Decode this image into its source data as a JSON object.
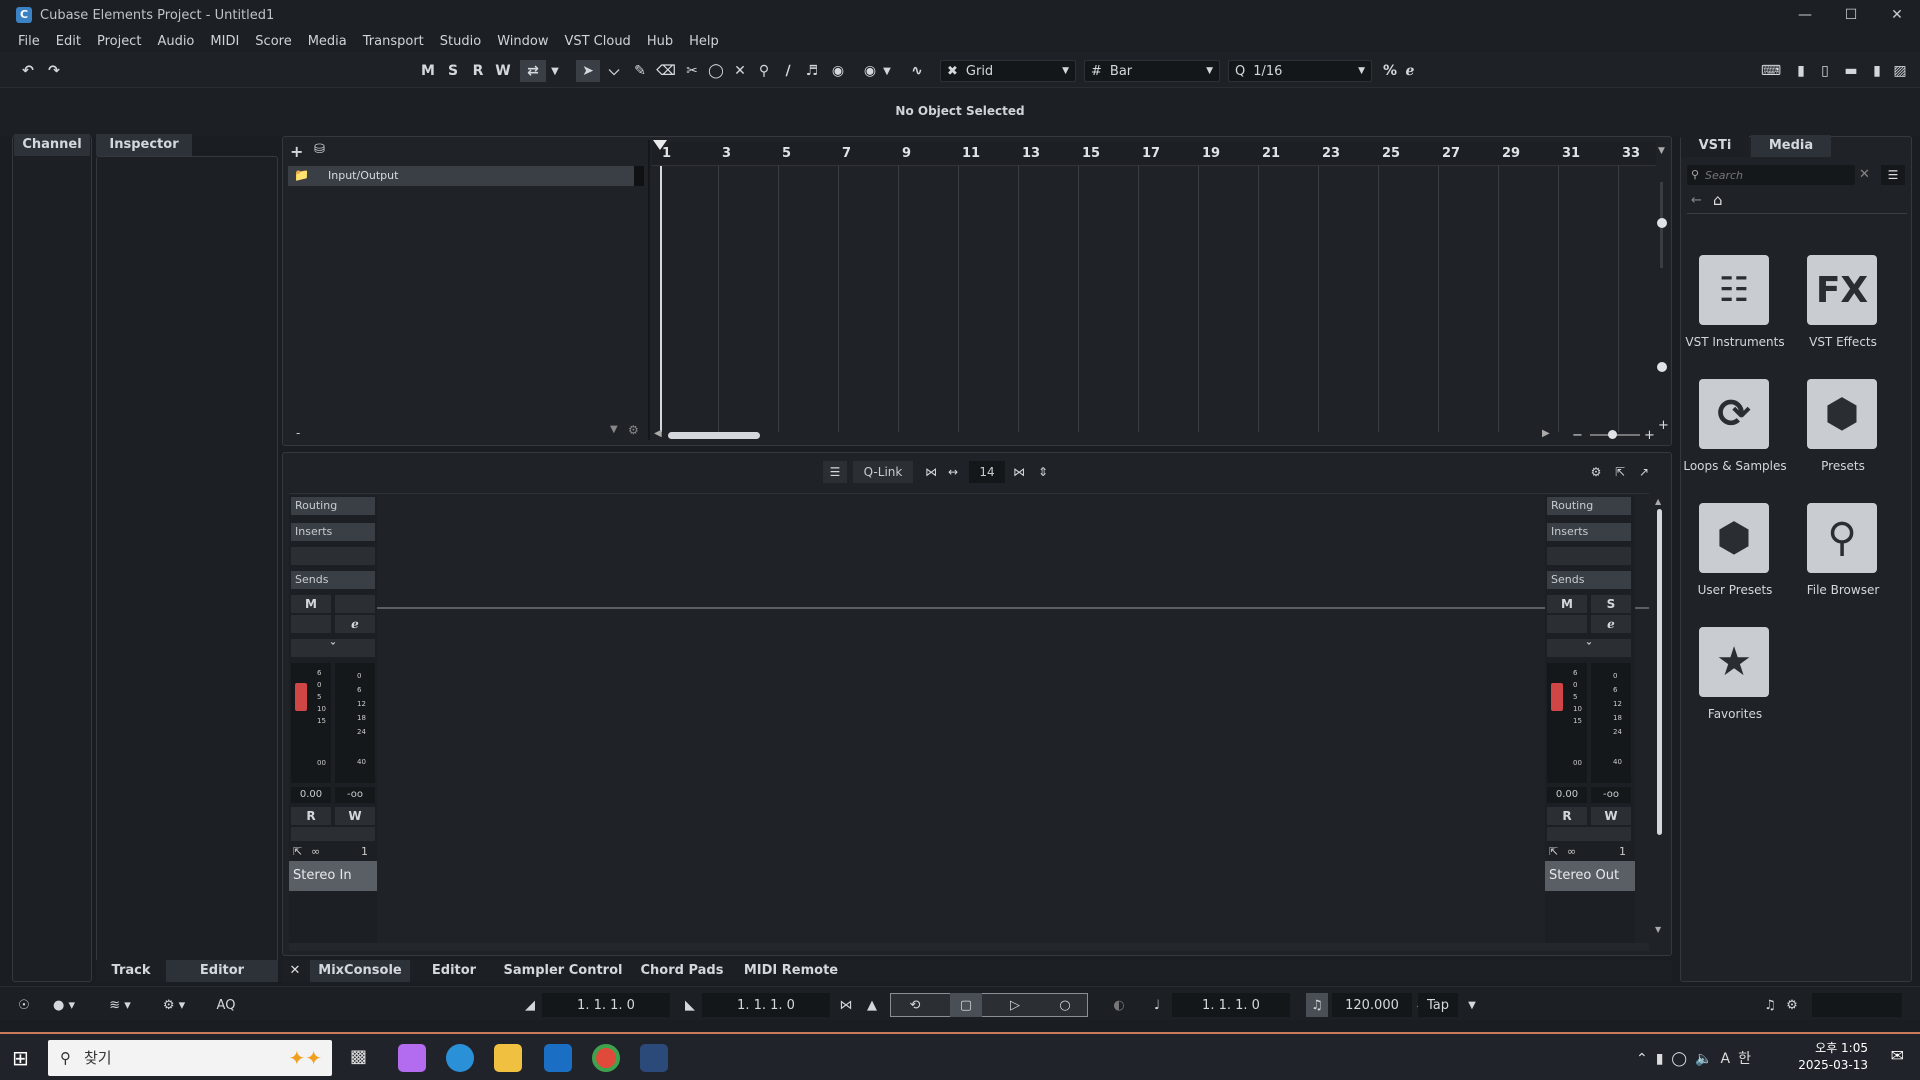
{
  "window": {
    "title": "Cubase Elements Project - Untitled1"
  },
  "menu": [
    "File",
    "Edit",
    "Project",
    "Audio",
    "MIDI",
    "Score",
    "Media",
    "Transport",
    "Studio",
    "Window",
    "VST Cloud",
    "Hub",
    "Help"
  ],
  "toolbar": {
    "m": "M",
    "s": "S",
    "r": "R",
    "w": "W",
    "snap_type": "Grid",
    "grid_type": "Bar",
    "quantize": "1/16"
  },
  "info_line": "No Object Selected",
  "left_tabs": {
    "channel": "Channel",
    "inspector": "Inspector",
    "track": "Track",
    "editor": "Editor"
  },
  "track_list": {
    "folder_name": "Input/Output",
    "footer": "-"
  },
  "ruler": [
    "1",
    "3",
    "5",
    "7",
    "9",
    "11",
    "13",
    "15",
    "17",
    "19",
    "21",
    "23",
    "25",
    "27",
    "29",
    "31",
    "33"
  ],
  "mixer": {
    "qlink": "Q-Link",
    "channel_count": "14",
    "routing": "Routing",
    "inserts": "Inserts",
    "sends": "Sends",
    "left": {
      "b1": "M",
      "r": "R",
      "w": "W",
      "gain": "0.00",
      "peak": "-oo",
      "number": "1",
      "name": "Stereo In"
    },
    "right": {
      "b1": "M",
      "b2": "S",
      "r": "R",
      "w": "W",
      "gain": "0.00",
      "peak": "-oo",
      "number": "1",
      "name": "Stereo Out"
    },
    "fader_scale": [
      "6",
      "0",
      "5",
      "10",
      "15",
      "00"
    ],
    "meter_scale": [
      "0",
      "6",
      "12",
      "18",
      "24",
      "40"
    ]
  },
  "bottom_tabs": [
    "MixConsole",
    "Editor",
    "Sampler Control",
    "Chord Pads",
    "MIDI Remote"
  ],
  "right_panel": {
    "tabs": {
      "vsti": "VSTi",
      "media": "Media"
    },
    "search_placeholder": "Search",
    "tiles": [
      "VST Instruments",
      "VST Effects",
      "Loops & Samples",
      "Presets",
      "User Presets",
      "File Browser",
      "Favorites"
    ]
  },
  "transport": {
    "left_locator": "1. 1. 1.   0",
    "right_locator": "1. 1. 1.   0",
    "position": "1. 1. 1.   0",
    "tempo": "120.000",
    "tap": "Tap",
    "aq": "AQ"
  },
  "taskbar": {
    "search_text": "찾기",
    "time": "오후 1:05",
    "date": "2025-03-13"
  },
  "colors": {
    "accent": "#d04545",
    "tile": "#c9ccd0",
    "bg": "#1a1d21"
  }
}
